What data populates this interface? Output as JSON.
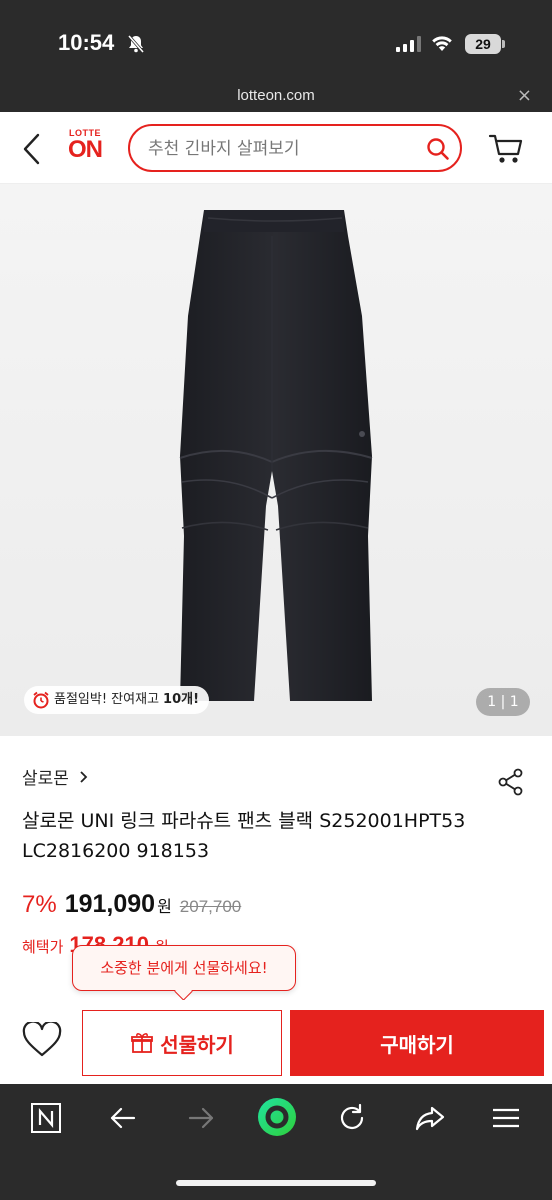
{
  "status_bar": {
    "time": "10:54",
    "battery": "29"
  },
  "url_bar": {
    "url": "lotteon.com",
    "close": "×"
  },
  "header": {
    "logo_top": "LOTTE",
    "logo_main": "ON",
    "search_placeholder": "추천 긴바지 살펴보기"
  },
  "gallery": {
    "stock_notice_prefix": "품절임박! 잔여재고 ",
    "stock_notice_count": "10개!",
    "image_counter": "1 | 1"
  },
  "product": {
    "brand": "살로몬",
    "title": "살로몬 UNI 링크 파라슈트 팬츠 블랙 S252001HPT53 LC2816200 918153",
    "discount": "7%",
    "price": "191,090",
    "currency": "원",
    "original_price": "207,700",
    "benefit_label": "혜택가",
    "benefit_price": "178,210",
    "benefit_currency": "원"
  },
  "tooltip": {
    "text": "소중한 분에게 선물하세요!"
  },
  "actions": {
    "gift_label": "선물하기",
    "buy_label": "구매하기"
  },
  "colors": {
    "accent": "#e5221e",
    "dark_bar": "#2b2b2b"
  },
  "browser_toolbar": {
    "icons": [
      "naver-n-icon",
      "back-arrow-icon",
      "forward-arrow-icon",
      "green-circle-icon",
      "reload-icon",
      "share-arrow-icon",
      "menu-icon"
    ]
  }
}
